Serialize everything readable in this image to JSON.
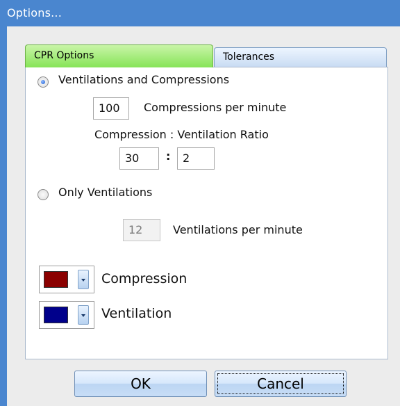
{
  "window": {
    "title": "Options..."
  },
  "tabs": [
    {
      "label": "CPR Options",
      "active": true
    },
    {
      "label": "Tolerances",
      "active": false
    }
  ],
  "cpr": {
    "mode_ventilations_and_compressions": {
      "label": "Ventilations and Compressions",
      "selected": true
    },
    "compressions_per_minute": {
      "value": "100",
      "label": "Compressions per minute"
    },
    "ratio": {
      "label": "Compression : Ventilation Ratio",
      "compression": "30",
      "separator": ":",
      "ventilation": "2"
    },
    "mode_only_ventilations": {
      "label": "Only Ventilations",
      "selected": false
    },
    "ventilations_per_minute": {
      "value": "12",
      "label": "Ventilations per minute",
      "enabled": false
    }
  },
  "colors": {
    "compression": {
      "label": "Compression",
      "color": "#8b0000"
    },
    "ventilation": {
      "label": "Ventilation",
      "color": "#00008b"
    }
  },
  "buttons": {
    "ok": "OK",
    "cancel": "Cancel"
  }
}
